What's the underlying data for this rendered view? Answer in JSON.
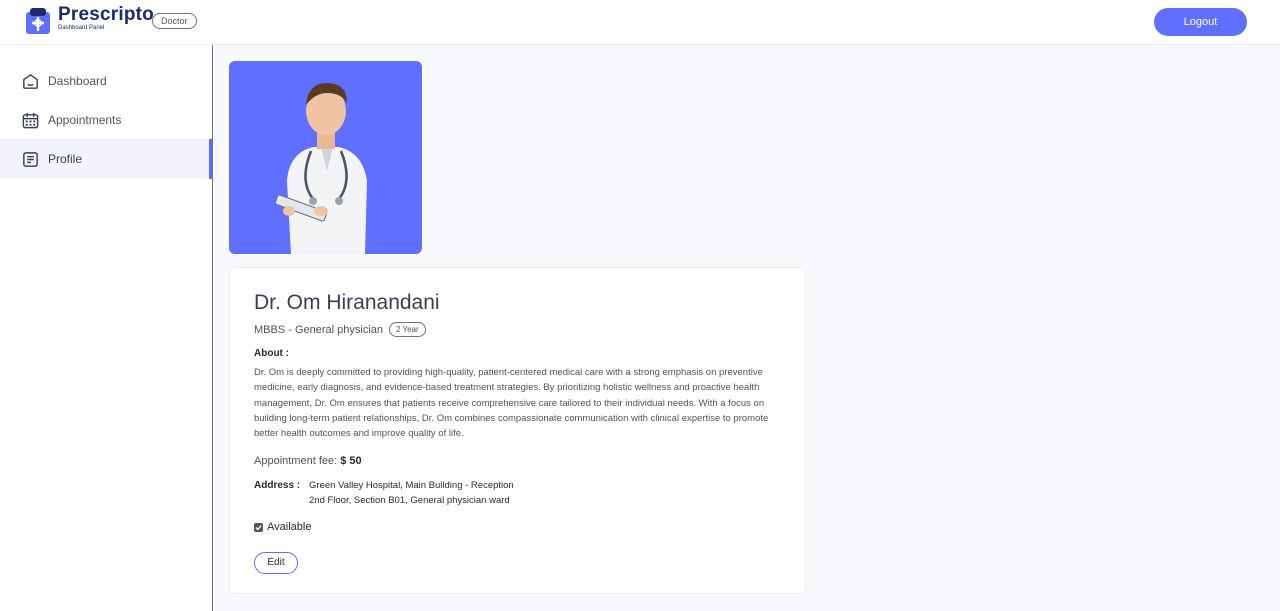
{
  "header": {
    "brand_name": "Prescripto",
    "brand_subtitle": "Dashboard Panel",
    "role_badge": "Doctor",
    "logout_label": "Logout"
  },
  "sidebar": {
    "items": [
      {
        "label": "Dashboard",
        "icon": "home-icon",
        "active": false
      },
      {
        "label": "Appointments",
        "icon": "calendar-icon",
        "active": false
      },
      {
        "label": "Profile",
        "icon": "profile-icon",
        "active": true
      }
    ]
  },
  "profile": {
    "name": "Dr. Om Hiranandani",
    "degree": "MBBS - General physician",
    "experience": "2 Year",
    "about_label": "About :",
    "about_text": "Dr. Om is deeply committed to providing high-quality, patient-centered medical care with a strong emphasis on preventive medicine, early diagnosis, and evidence-based treatment strategies. By prioritizing holistic wellness and proactive health management, Dr. Om ensures that patients receive comprehensive care tailored to their individual needs. With a focus on building long-term patient relationships, Dr. Om combines compassionate communication with clinical expertise to promote better health outcomes and improve quality of life.",
    "fee_label": "Appointment fee:",
    "fee_value": "$ 50",
    "address_label": "Address :",
    "address_line1": "Green Valley Hospital, Main Building - Reception",
    "address_line2": "2nd Floor, Section B01, General physician ward",
    "available_label": "Available",
    "available": true,
    "edit_label": "Edit"
  },
  "colors": {
    "accent": "#5f6fff",
    "brand_dark": "#1f2a6b",
    "sidebar_active_bg": "#f2f3ff",
    "main_bg": "#f8f9fd"
  }
}
